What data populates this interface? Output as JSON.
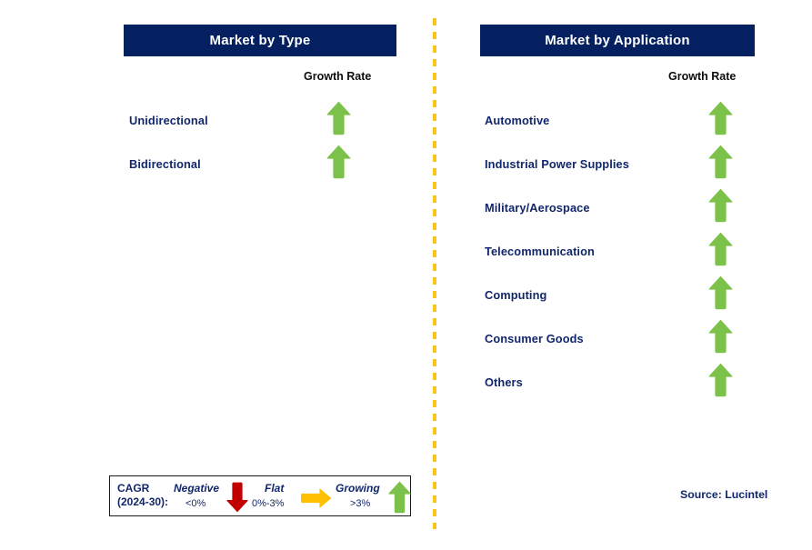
{
  "panels": {
    "type": {
      "title": "Market by Type",
      "growth_caption": "Growth Rate",
      "segments": [
        {
          "label": "Unidirectional",
          "growth": "growing",
          "arrow_icon": "arrow-up-icon"
        },
        {
          "label": "Bidirectional",
          "growth": "growing",
          "arrow_icon": "arrow-up-icon"
        }
      ]
    },
    "application": {
      "title": "Market by Application",
      "growth_caption": "Growth Rate",
      "segments": [
        {
          "label": "Automotive",
          "growth": "growing",
          "arrow_icon": "arrow-up-icon"
        },
        {
          "label": "Industrial Power Supplies",
          "growth": "growing",
          "arrow_icon": "arrow-up-icon"
        },
        {
          "label": "Military/Aerospace",
          "growth": "growing",
          "arrow_icon": "arrow-up-icon"
        },
        {
          "label": "Telecommunication",
          "growth": "growing",
          "arrow_icon": "arrow-up-icon"
        },
        {
          "label": "Computing",
          "growth": "growing",
          "arrow_icon": "arrow-up-icon"
        },
        {
          "label": "Consumer Goods",
          "growth": "growing",
          "arrow_icon": "arrow-up-icon"
        },
        {
          "label": "Others",
          "growth": "growing",
          "arrow_icon": "arrow-up-icon"
        }
      ]
    }
  },
  "legend": {
    "cagr_line1": "CAGR",
    "cagr_line2": "(2024-30):",
    "items": [
      {
        "title": "Negative",
        "range": "<0%",
        "icon": "arrow-down-icon",
        "color": "#C00000"
      },
      {
        "title": "Flat",
        "range": "0%-3%",
        "icon": "arrow-right-icon",
        "color": "#FFC000"
      },
      {
        "title": "Growing",
        "range": ">3%",
        "icon": "arrow-up-icon",
        "color": "#7CC24A"
      }
    ]
  },
  "source": "Source: Lucintel",
  "colors": {
    "header_bg": "#052060",
    "header_text": "#FFFFFF",
    "label_text": "#12276B",
    "growing_arrow": "#7CC24A",
    "negative_arrow": "#C00000",
    "flat_arrow": "#FFC000",
    "divider": "#FCC416",
    "legend_border": "#1A1A1A"
  }
}
